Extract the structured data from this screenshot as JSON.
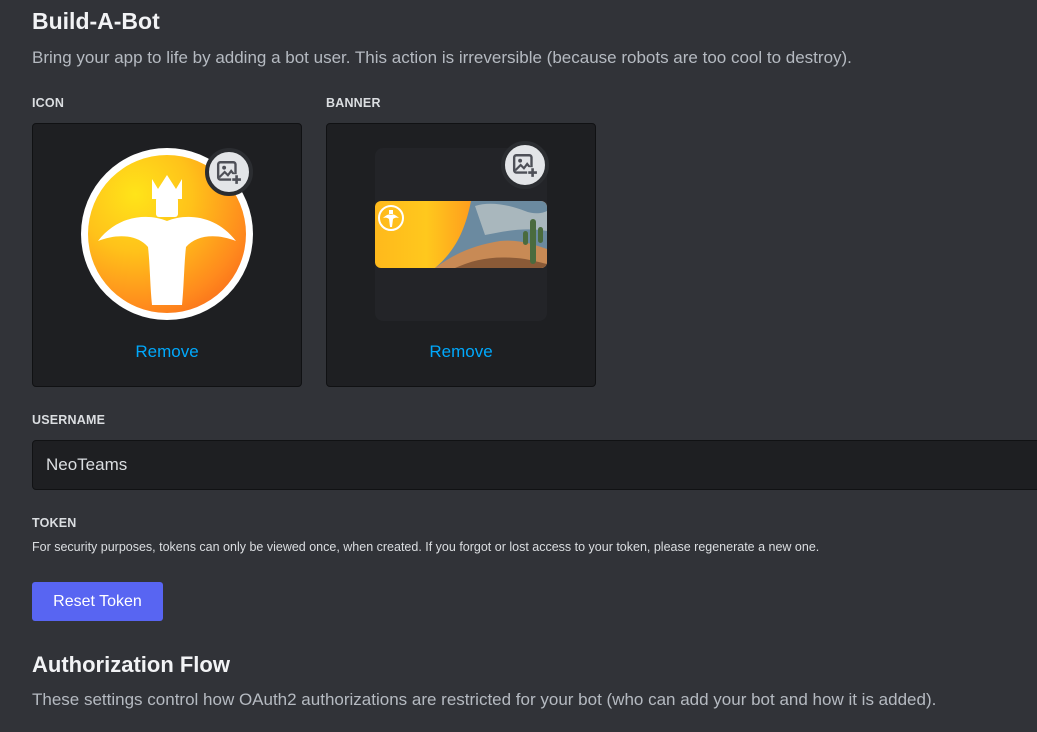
{
  "build_a_bot": {
    "title": "Build-A-Bot",
    "description": "Bring your app to life by adding a bot user. This action is irreversible (because robots are too cool to destroy)."
  },
  "icon_section": {
    "label": "ICON",
    "remove_label": "Remove",
    "upload_icon": "image-plus-icon"
  },
  "banner_section": {
    "label": "BANNER",
    "remove_label": "Remove",
    "upload_icon": "image-plus-icon"
  },
  "username": {
    "label": "USERNAME",
    "value": "NeoTeams"
  },
  "token": {
    "label": "TOKEN",
    "help_text": "For security purposes, tokens can only be viewed once, when created. If you forgot or lost access to your token, please regenerate a new one.",
    "reset_button_label": "Reset Token"
  },
  "authorization_flow": {
    "title": "Authorization Flow",
    "description": "These settings control how OAuth2 authorizations are restricted for your bot (who can add your bot and how it is added)."
  },
  "colors": {
    "background": "#313338",
    "card_background": "#1e1f22",
    "link": "#00a8fc",
    "button_primary": "#5865f2"
  }
}
